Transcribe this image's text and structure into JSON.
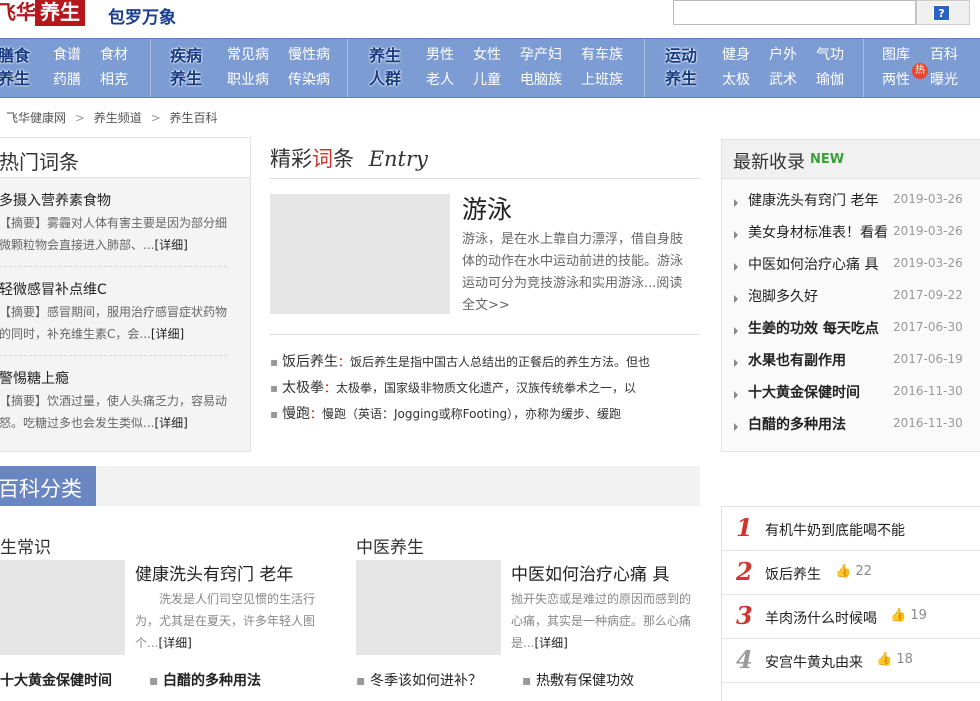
{
  "header": {
    "logo_left": "飞华",
    "logo_right": "养生",
    "slogan": "包罗万象",
    "search_placeholder": "",
    "search_button": "?"
  },
  "nav": {
    "groups": [
      {
        "cat": [
          "膳食",
          "养生"
        ],
        "links": [
          [
            "食谱",
            "食材"
          ],
          [
            "药膳",
            "相克"
          ]
        ]
      },
      {
        "cat": [
          "疾病",
          "养生"
        ],
        "links": [
          [
            "常见病",
            "慢性病"
          ],
          [
            "职业病",
            "传染病"
          ]
        ]
      },
      {
        "cat": [
          "养生",
          "人群"
        ],
        "links": [
          [
            "男性",
            "女性",
            "孕产妇",
            "有车族"
          ],
          [
            "老人",
            "儿童",
            "电脑族",
            "上班族"
          ]
        ]
      },
      {
        "cat": [
          "运动",
          "养生"
        ],
        "links": [
          [
            "健身",
            "户外",
            "气功"
          ],
          [
            "太极",
            "武术",
            "瑜伽"
          ]
        ]
      },
      {
        "cat": [],
        "links": [
          [
            "图库",
            "百科"
          ],
          [
            "两性",
            "曝光"
          ]
        ],
        "badge": "热"
      }
    ]
  },
  "breadcrumb": {
    "items": [
      "飞华健康网",
      "养生频道",
      "养生百科"
    ],
    "sep": ">"
  },
  "hot": {
    "title": "热门词条",
    "items": [
      {
        "title": "多摄入营养素食物",
        "desc1": "【摘要】雾霾对人体有害主要是因为部分细",
        "desc2": "微颗粒物会直接进入肺部、...",
        "more": "[详细]"
      },
      {
        "title": "轻微感冒补点维C",
        "desc1": "【摘要】感冒期间，服用治疗感冒症状药物",
        "desc2": "的同时，补充维生素C，会...",
        "more": "[详细]"
      },
      {
        "title": "警惕糖上瘾",
        "desc1": "【摘要】饮酒过量，使人头痛乏力，容易动",
        "desc2": "怒。吃糖过多也会发生类似...",
        "more": "[详细]"
      }
    ]
  },
  "entry": {
    "title_a": "精彩",
    "title_b": "词",
    "title_c": "条",
    "title_en": "Entry",
    "main_title": "游泳",
    "main_desc": [
      "游泳，是在水上靠自力漂浮，借自身肢",
      "体的动作在水中运动前进的技能。游泳",
      "运动可分为竞技游泳和实用游泳...阅读",
      "全文>>"
    ],
    "bullets": [
      {
        "t": "饭后养生",
        "d": "饭后养生是指中国古人总结出的正餐后的养生方法。但也"
      },
      {
        "t": "太极拳",
        "d": "太极拳，国家级非物质文化遗产，汉族传统拳术之一，以"
      },
      {
        "t": "慢跑",
        "d": "慢跑（英语：Jogging或称Footing），亦称为缓步、缓跑"
      }
    ]
  },
  "latest": {
    "title": "最新收录",
    "new": "NEW",
    "items": [
      {
        "title": "健康洗头有窍门 老年",
        "date": "2019-03-26",
        "bold": false
      },
      {
        "title": "美女身材标准表！看看",
        "date": "2019-03-26",
        "bold": false
      },
      {
        "title": "中医如何治疗心痛 具",
        "date": "2019-03-26",
        "bold": false
      },
      {
        "title": "泡脚多久好",
        "date": "2017-09-22",
        "bold": false
      },
      {
        "title": "生姜的功效 每天吃点",
        "date": "2017-06-30",
        "bold": true
      },
      {
        "title": "水果也有副作用",
        "date": "2017-06-19",
        "bold": true
      },
      {
        "title": "十大黄金保健时间",
        "date": "2016-11-30",
        "bold": true
      },
      {
        "title": "白醋的多种用法",
        "date": "2016-11-30",
        "bold": true
      }
    ]
  },
  "baike": {
    "title": "百科分类",
    "col1": {
      "heading": "生常识",
      "title": "健康洗头有窍门 老年",
      "desc": [
        "洗发是人们司空见惯的生活行",
        "为，尤其是在夏天，许多年轻人图",
        "个..."
      ],
      "more": "[详细]",
      "links": [
        "十大黄金保健时间",
        "白醋的多种用法"
      ]
    },
    "col2": {
      "heading": "中医养生",
      "title": "中医如何治疗心痛 具",
      "desc": [
        "抛开失恋或是难过的原因而感到的",
        "心痛，其实是一种病症。那么心痛",
        "是..."
      ],
      "more": "[详细]",
      "links": [
        "冬季该如何进补？",
        "热敷有保健功效"
      ]
    }
  },
  "ranking": {
    "items": [
      {
        "num": "1",
        "title": "有机牛奶到底能喝不能",
        "likes": null
      },
      {
        "num": "2",
        "title": "饭后养生",
        "likes": "22"
      },
      {
        "num": "3",
        "title": "羊肉汤什么时候喝",
        "likes": "19"
      },
      {
        "num": "4",
        "title": "安宫牛黄丸由来",
        "likes": "18"
      }
    ]
  },
  "colors": {
    "nav_bg": "#7c9cd3",
    "brand_red": "#b5171d",
    "baike_tab": "#6a86c2",
    "new_green": "#3aa13a"
  }
}
